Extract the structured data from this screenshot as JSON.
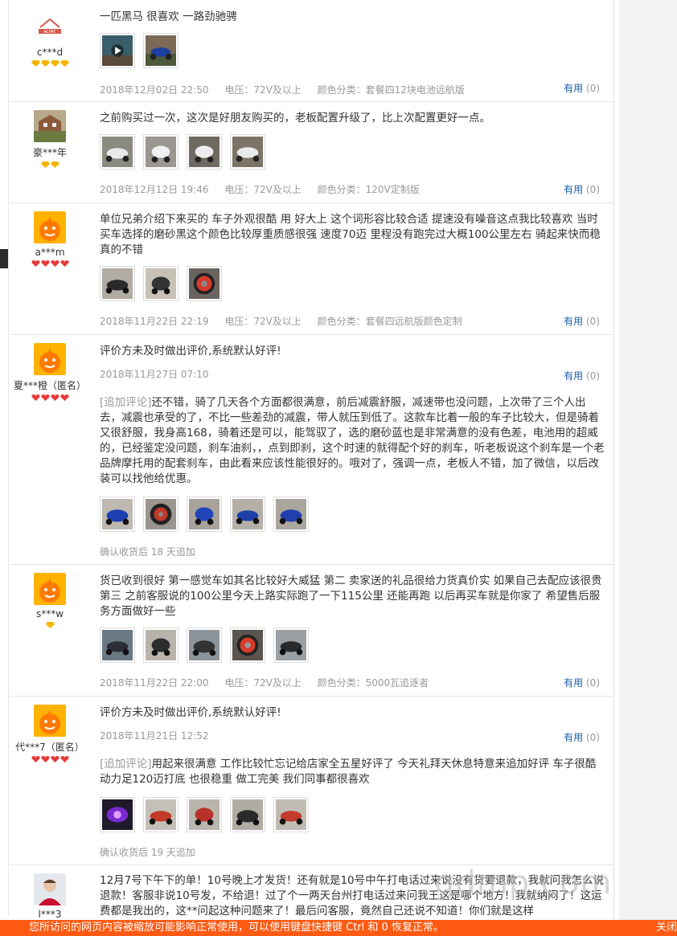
{
  "reviews": [
    {
      "user": "c***d",
      "avatar": "alpat-logo",
      "rank": [
        "yellow",
        "yellow",
        "yellow",
        "yellow"
      ],
      "text": "一匹黑马 很喜欢 一路劲驰骋",
      "date": "2018年12月02日 22:50",
      "voltage": "电压：72V及以上",
      "color": "颜色分类：套餐四12块电池远航版",
      "useful_label": "有用",
      "useful_count": "(0)",
      "thumbs": [
        "video",
        "blue-scooter"
      ]
    },
    {
      "user": "豪***年",
      "avatar": "house-photo",
      "rank": [
        "yellow",
        "yellow"
      ],
      "text": "之前购买过一次，这次是好朋友购买的，老板配置升级了，比上次配置更好一点。",
      "date": "2018年12月12日 19:46",
      "voltage": "电压：72V及以上",
      "color": "颜色分类：120V定制版",
      "useful_label": "有用",
      "useful_count": "(0)",
      "thumbs": [
        "white",
        "white",
        "white",
        "white"
      ]
    },
    {
      "user": "a***m",
      "avatar": "orange-default",
      "rank": [
        "red",
        "red",
        "red",
        "red"
      ],
      "text": "单位兄弟介绍下来买的 车子外观很酷 用 好大上 这个词形容比较合适 提速没有噪音这点我比较喜欢 当时买车选择的磨砂黑这个颜色比较厚重质感很强 速度70迈 里程没有跑完过大概100公里左右 骑起来快而稳 真的不错",
      "date": "2018年11月22日 22:19",
      "voltage": "电压：72V及以上",
      "color": "颜色分类：套餐四远航版颜色定制",
      "useful_label": "有用",
      "useful_count": "(0)",
      "thumbs": [
        "dark",
        "dark",
        "red-wheel"
      ]
    },
    {
      "user": "夏***橙（匿名）",
      "avatar": "orange-default",
      "rank": [
        "red",
        "red",
        "red",
        "red"
      ],
      "text": "评价方未及时做出评价,系统默认好评!",
      "date": "2018年11月27日 07:10",
      "useful_label": "有用",
      "useful_count": "(0)",
      "append_tag": "[追加评论]",
      "append_text": "还不错，骑了几天各个方面都很满意，前后减震舒服，减速带也没问题，上次带了三个人出去，减震也承受的了，不比一些差劲的减震，带人就压到低了。这款车比着一般的车子比较大，但是骑着又很舒服，我身高168，骑着还是可以，能驾驭了，选的磨砂蓝也是非常满意的没有色差，电池用的超威的，已经鉴定没问题，刹车油刹，，点到即刹，这个时速的就得配个好的刹车，听老板说这个刹车是一个老品牌摩托用的配套刹车，由此看来应该性能很好的。哦对了，强调一点，老板人不错，加了微信，以后改装可以找他给优惠。",
      "thumbs": [
        "blue",
        "blue-wheel",
        "blue",
        "blue",
        "blue"
      ],
      "append_note": "确认收货后 18 天追加"
    },
    {
      "user": "s***w",
      "avatar": "orange-default",
      "rank": [
        "yellow"
      ],
      "text": "货已收到很好 第一感觉车如其名比较好大威猛 第二 卖家送的礼品很给力货真价实 如果自己去配应该很贵 第三 之前客服说的100公里今天上路实际跑了一下115公里 还能再跑 以后再买车就是你家了 希望售后服务方面做好一些",
      "date": "2018年11月22日 22:00",
      "voltage": "电压：72V及以上",
      "color": "颜色分类：5000瓦追逐者",
      "useful_label": "有用",
      "useful_count": "(0)",
      "thumbs": [
        "dark",
        "dark",
        "dark",
        "red-wheel",
        "dark"
      ]
    },
    {
      "user": "代***7（匿名）",
      "avatar": "orange-default",
      "rank": [
        "red",
        "red",
        "red",
        "red"
      ],
      "text": "评价方未及时做出评价,系统默认好评!",
      "date": "2018年11月21日 12:52",
      "useful_label": "有用",
      "useful_count": "(0)",
      "append_tag": "[追加评论]",
      "append_text": "用起来很满意 工作比较忙忘记给店家全五星好评了 今天礼拜天休息特意来追加好评 车子很酷 动力足120迈打底 也很稳重 做工完美 我们同事都很喜欢",
      "thumbs": [
        "purple",
        "red",
        "red",
        "dark",
        "red"
      ],
      "append_note": "确认收货后 19 天追加"
    },
    {
      "user": "l***3",
      "avatar": "person-photo",
      "text": "12月7号下午下的单！10号晚上才发货！还有就是10号中午打电话过来说没有货要退款，我就问我怎么说退款！客服非说10号发，不给退！过了个一两天台州打电话过来问我王这是哪个地方！我就纳闷了！这运费都是我出的，这**问起这种问题来了！最后问客服，竟然自己还说不知道！你们就是这样"
    }
  ],
  "banner_text": "您所访问的网页内容被缩放可能影响正常使用，可以使用键盘快捷键 Ctrl 和 0 恢复正常。",
  "banner_right": "关闭",
  "watermark": "gdmp.com",
  "colors": {
    "useful": "#1a5fa8",
    "banner": "#ff5a13",
    "meta": "#999999"
  }
}
